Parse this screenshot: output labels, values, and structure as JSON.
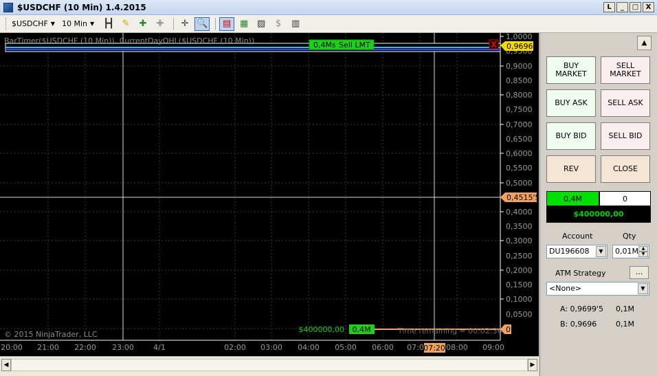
{
  "window": {
    "title": "$USDCHF (10 Min)  1.4.2015",
    "buttons": [
      "L",
      "_",
      "□",
      "X"
    ]
  },
  "toolbar": {
    "instrument": "$USDCHF",
    "interval": "10 Min"
  },
  "chart": {
    "indicator_label": "BarTimer($USDCHF (10 Min)), CurrentDayOHL($USDCHF (10 Min))",
    "copyright": "© 2015 NinjaTrader, LLC",
    "time_remaining": "Time remaining = 00:02:36",
    "order_size_top": "0,4Ms",
    "order_type_top": "Sell LMT",
    "order_close_x": "X",
    "price_top": "0,9696",
    "price_mid": "0,4515'5",
    "position_value": "$400000,00",
    "position_size": "0,4M",
    "bottom_marker": "0",
    "current_time": "07:20",
    "y_ticks": [
      "1,0000",
      "0,9500",
      "0,9000",
      "0,8500",
      "0,8000",
      "0,7500",
      "0,7000",
      "0,6500",
      "0,6000",
      "0,5500",
      "0,5000",
      "0,4500",
      "0,4000",
      "0,3500",
      "0,3000",
      "0,2500",
      "0,2000",
      "0,1500",
      "0,1000",
      "0,0500",
      "0"
    ],
    "x_ticks": [
      "20:00",
      "21:00",
      "22:00",
      "23:00",
      "4/1",
      "02:00",
      "03:00",
      "04:00",
      "05:00",
      "06:00",
      "07:00",
      "08:00",
      "09:00"
    ]
  },
  "panel": {
    "buy_market": "BUY MARKET",
    "sell_market": "SELL MARKET",
    "buy_ask": "BUY ASK",
    "sell_ask": "SELL ASK",
    "buy_bid": "BUY BID",
    "sell_bid": "SELL BID",
    "rev": "REV",
    "close": "CLOSE",
    "position_size": "0,4M",
    "position_other": "0",
    "pnl": "$400000,00",
    "account_label": "Account",
    "qty_label": "Qty",
    "account_value": "DU196608",
    "qty_value": "0,01M",
    "atm_label": "ATM Strategy",
    "atm_dots": "...",
    "atm_value": "<None>",
    "ask_label": "A: 0,9699'5",
    "ask_size": "0,1M",
    "bid_label": "B: 0,9696",
    "bid_size": "0,1M"
  }
}
